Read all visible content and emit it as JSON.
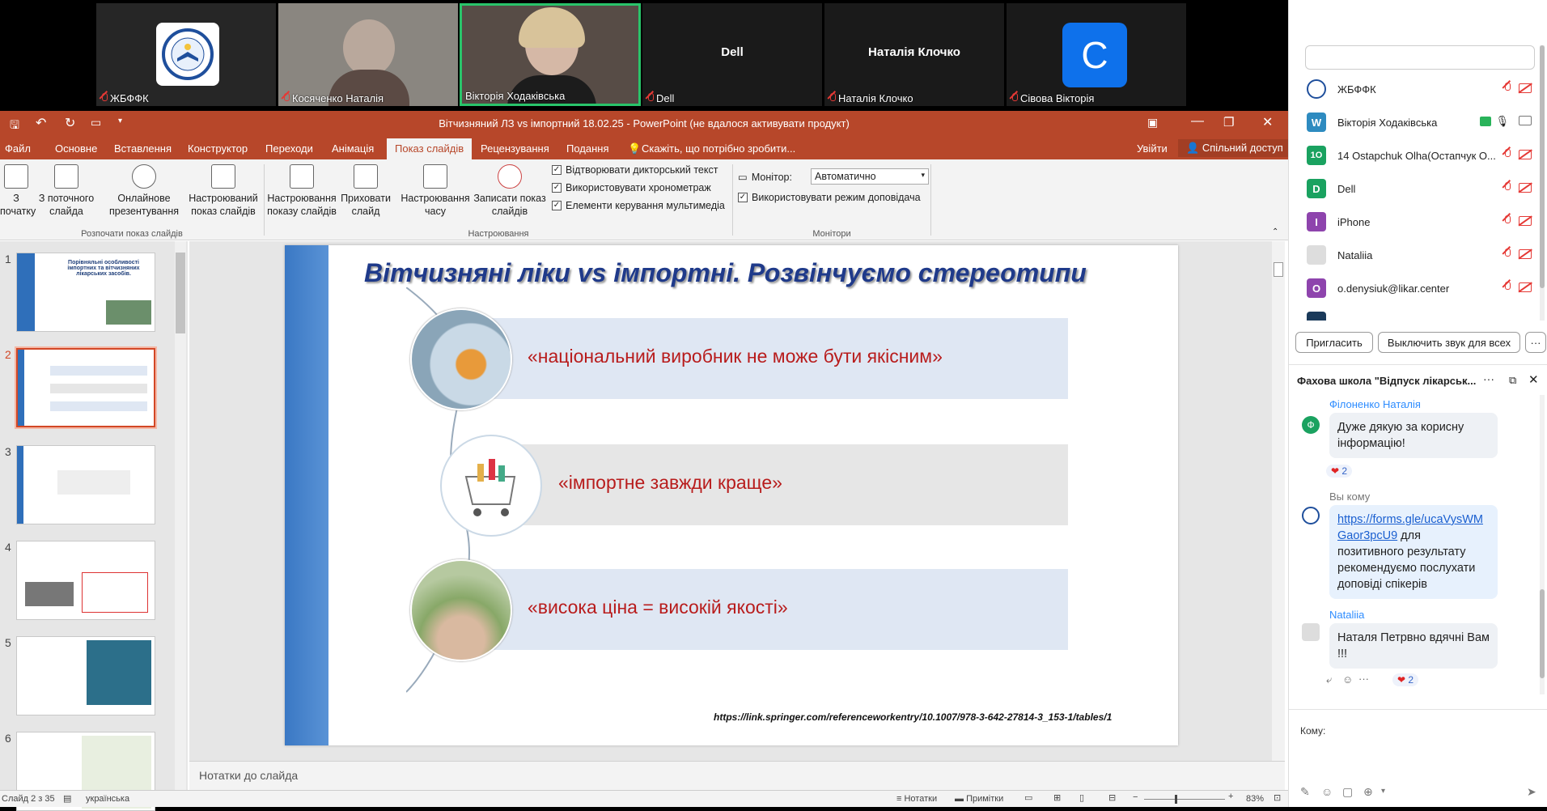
{
  "zoom": {
    "tiles": [
      {
        "name": "ЖБФФК",
        "type": "logo"
      },
      {
        "name": "Косяченко Наталія",
        "type": "video"
      },
      {
        "name": "Вікторія Ходаківська",
        "type": "video",
        "active": true
      },
      {
        "name": "Dell",
        "type": "name-only"
      },
      {
        "name": "Наталія Клочко",
        "type": "name-only"
      },
      {
        "name": "Сівова Вікторія",
        "type": "avatar",
        "initial": "C",
        "color": "#0e71eb"
      }
    ]
  },
  "ppt": {
    "title": "Вітчизняний ЛЗ vs імпортний 18.02.25  -  PowerPoint (не вдалося активувати продукт)",
    "menu": [
      "Файл",
      "Основне",
      "Вставлення",
      "Конструктор",
      "Переходи",
      "Анімація",
      "Показ слайдів",
      "Рецензування",
      "Подання"
    ],
    "tellme": "Скажіть, що потрібно зробити...",
    "signin": "Увійти",
    "share": "Спільний доступ",
    "ribbon": {
      "b1": "З\nпочатку",
      "b2": "З поточного\nслайда",
      "b3": "Онлайнове\nпрезентування",
      "b4": "Настроюваний\nпоказ слайдів",
      "g1": "Розпочати показ слайдів",
      "b5": "Настроювання\nпоказу слайдів",
      "b6": "Приховати\nслайд",
      "b7": "Настроювання\nчасу",
      "b8": "Записати показ\nслайдів",
      "c1": "Відтворювати дикторський текст",
      "c2": "Використовувати хронометраж",
      "c3": "Елементи керування мультимедіа",
      "g2": "Настроювання",
      "monitor_label": "Монітор:",
      "monitor_value": "Автоматично",
      "c4": "Використовувати режим доповідача",
      "g3": "Монітори"
    },
    "thumbs": [
      "1",
      "2",
      "3",
      "4",
      "5",
      "6"
    ],
    "thumb1_title": "Порівняльні особливості імпортних та вітчизняних лікарських засобів.",
    "slide": {
      "title": "Вітчизняні ліки vs імпортні. Розвінчуємо стереотипи",
      "items": [
        "«національний виробник не може бути якісним»",
        "«імпортне завжди краще»",
        "«висока ціна = високій якості»"
      ],
      "link": "https://link.springer.com/referenceworkentry/10.1007/978-3-642-27814-3_153-1/tables/1"
    },
    "notes": "Нотатки до слайда",
    "status": {
      "slide": "Слайд 2 з 35",
      "lang": "українська",
      "notes": "Нотатки",
      "comments": "Примітки",
      "zoom": "83%"
    }
  },
  "panel": {
    "search": "",
    "participants": [
      {
        "name": "ЖБФФК",
        "color": "#ffffff",
        "initial": "",
        "logo": true
      },
      {
        "name": "Вікторія Ходаківська",
        "color": "#2e9d6e",
        "initial": "W",
        "host": true
      },
      {
        "name": "14 Ostapchuk Olha(Остапчук О...",
        "color": "#1aa260",
        "initial": "1O"
      },
      {
        "name": "Dell",
        "color": "#1aa260",
        "initial": "D"
      },
      {
        "name": "iPhone",
        "color": "#8e44ad",
        "initial": "I"
      },
      {
        "name": "Nataliia",
        "color": "#dddddd",
        "initial": ""
      },
      {
        "name": "o.denysiuk@likar.center",
        "color": "#8e44ad",
        "initial": "O"
      }
    ],
    "invite": "Пригласить",
    "mute_all": "Выключить звук для всех",
    "more": "···",
    "chat_title": "Фахова школа \"Відпуск лікарськ...",
    "messages": {
      "m1_name": "Філоненко Наталія",
      "m1_initial": "Ф",
      "m1_text": "Дуже дякую за корисну інформацію!",
      "m1_react": "2",
      "m2_name": "Вы кому",
      "m2_link": "https://forms.gle/ucaVysWMGaor3pcU9",
      "m2_text": " для позитивного результату рекомендуємо послухати доповіді спікерів",
      "m3_name": "Nataliia",
      "m3_text": "Наталя Петрвно вдячні Вам !!!",
      "m3_react": "2"
    },
    "to_label": "Кому:"
  }
}
